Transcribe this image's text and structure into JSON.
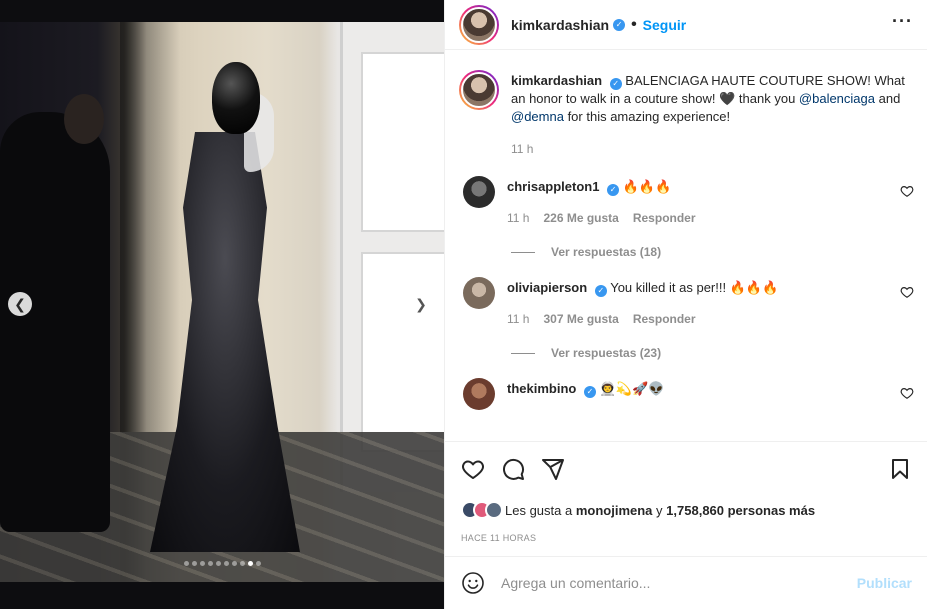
{
  "header": {
    "username": "kimkardashian",
    "separator": "•",
    "follow_label": "Seguir",
    "more_icon": "more-horizontal-icon"
  },
  "caption": {
    "username": "kimkardashian",
    "text_before": "BALENCIAGA HAUTE COUTURE SHOW! What an honor to walk in a couture show! 🖤 thank you ",
    "mention1": "@balenciaga",
    "text_mid": " and ",
    "mention2": "@demna",
    "text_after": " for this amazing experience!",
    "time": "11 h"
  },
  "comments": [
    {
      "username": "chrisappleton1",
      "text": "🔥🔥🔥",
      "time": "11 h",
      "likes": "226 Me gusta",
      "reply_label": "Responder",
      "view_replies": "Ver respuestas (18)",
      "avatar_color": "#2b2b2b"
    },
    {
      "username": "oliviapierson",
      "text": "You killed it as per!!! 🔥🔥🔥",
      "time": "11 h",
      "likes": "307 Me gusta",
      "reply_label": "Responder",
      "view_replies": "Ver respuestas (23)",
      "avatar_color": "#7a6a5c"
    },
    {
      "username": "thekimbino",
      "text": "👨‍🚀💫🚀👽",
      "avatar_color": "#6b3c2e"
    }
  ],
  "likes": {
    "prefix": "Les gusta a ",
    "user": "monojimena",
    "middle": " y ",
    "count": "1,758,860 personas más"
  },
  "timestamp": "HACE 11 HORAS",
  "add_comment": {
    "placeholder": "Agrega un comentario...",
    "publish_label": "Publicar"
  },
  "carousel": {
    "total": 10,
    "active_index": 8
  },
  "colors": {
    "accent": "#0095f6",
    "verified": "#3897f0",
    "mention": "#00376b",
    "publish_disabled": "#b2dffc"
  }
}
